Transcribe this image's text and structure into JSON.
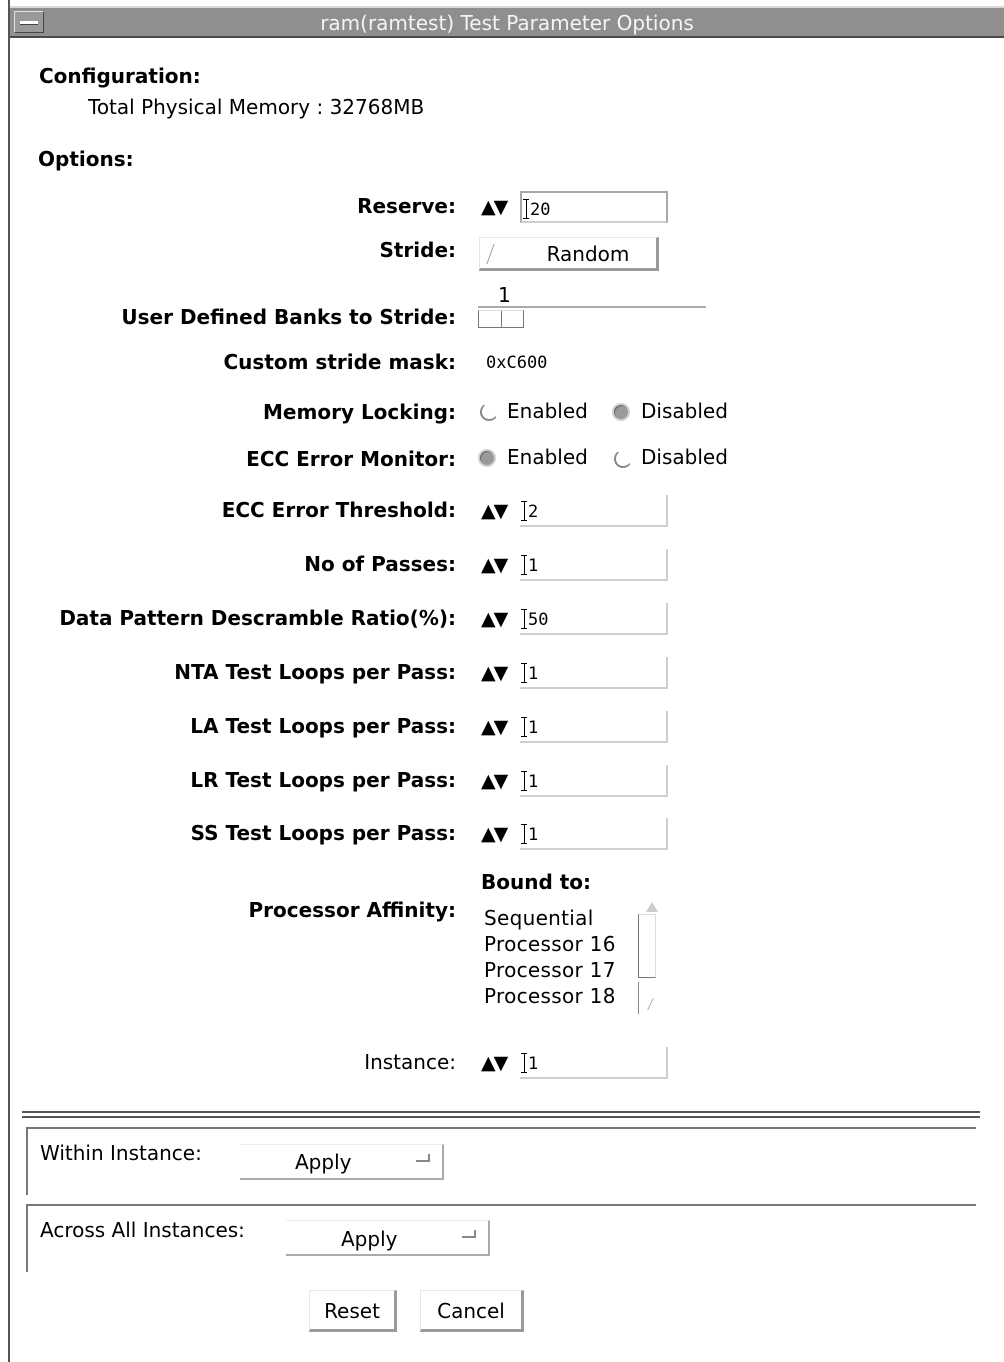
{
  "window": {
    "title": "ram(ramtest) Test Parameter Options"
  },
  "configuration": {
    "heading": "Configuration:",
    "memory_label": "Total Physical Memory : 32768MB"
  },
  "options": {
    "heading": "Options:",
    "reserve": {
      "label": "Reserve:",
      "value": "20"
    },
    "stride": {
      "label": "Stride:",
      "value": "Random"
    },
    "banks": {
      "label": "User Defined Banks to Stride:",
      "value": "1"
    },
    "mask": {
      "label": "Custom stride mask:",
      "value": "0xC600"
    },
    "memory_locking": {
      "label": "Memory Locking:",
      "option_enabled": "Enabled",
      "option_disabled": "Disabled",
      "selected": "Disabled"
    },
    "ecc_monitor": {
      "label": "ECC Error Monitor:",
      "option_enabled": "Enabled",
      "option_disabled": "Disabled",
      "selected": "Enabled"
    },
    "ecc_threshold": {
      "label": "ECC Error Threshold:",
      "value": "2"
    },
    "passes": {
      "label": "No of Passes:",
      "value": "1"
    },
    "descramble": {
      "label": "Data Pattern Descramble Ratio(%):",
      "value": "50"
    },
    "nta_loops": {
      "label": "NTA Test Loops per Pass:",
      "value": "1"
    },
    "la_loops": {
      "label": "LA Test Loops per Pass:",
      "value": "1"
    },
    "lr_loops": {
      "label": "LR Test Loops per Pass:",
      "value": "1"
    },
    "ss_loops": {
      "label": "SS Test Loops per Pass:",
      "value": "1"
    },
    "affinity": {
      "label": "Processor Affinity:",
      "bound_label": "Bound to:",
      "items": [
        "Sequential",
        "Processor 16",
        "Processor 17",
        "Processor 18"
      ]
    },
    "instance": {
      "label": "Instance:",
      "value": "1"
    }
  },
  "within": {
    "label": "Within Instance:",
    "action": "Apply"
  },
  "across": {
    "label": "Across All Instances:",
    "action": "Apply"
  },
  "buttons": {
    "reset": "Reset",
    "cancel": "Cancel"
  },
  "spinner_glyphs": "▲▼"
}
